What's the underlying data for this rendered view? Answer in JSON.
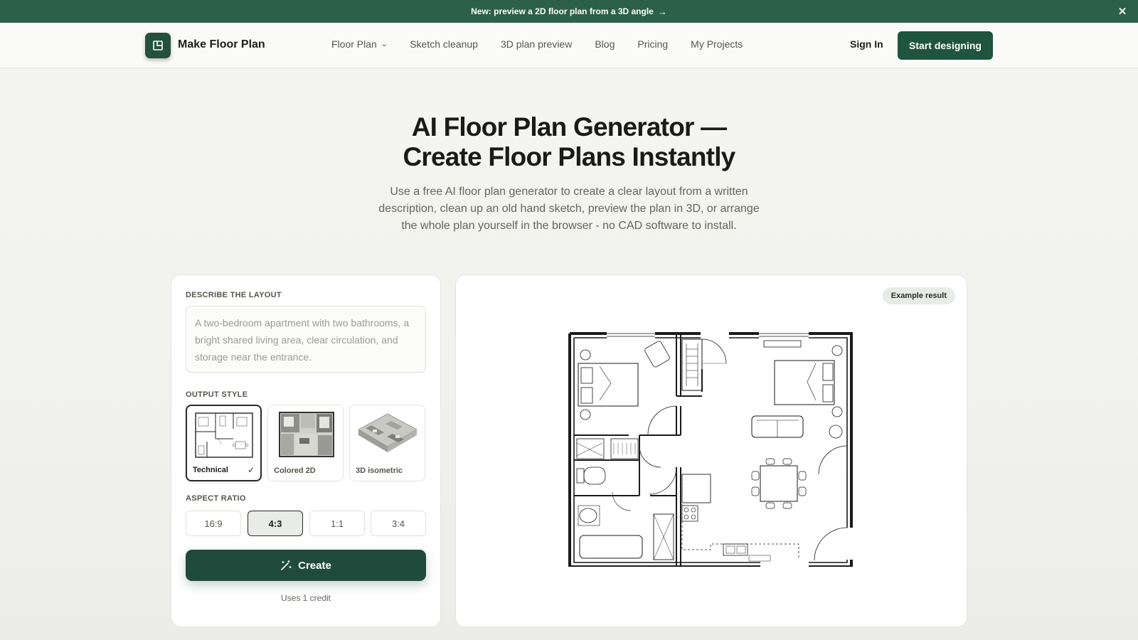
{
  "announcement": {
    "text": "New: preview a 2D floor plan from a 3D angle",
    "arrow": "→",
    "close_icon": "close-icon"
  },
  "header": {
    "brand": "Make Floor Plan",
    "logo_icon": "floor-plan-logo-icon",
    "nav": [
      {
        "label": "Floor Plan",
        "has_dropdown": true
      },
      {
        "label": "Sketch cleanup"
      },
      {
        "label": "3D plan preview"
      },
      {
        "label": "Blog"
      },
      {
        "label": "Pricing"
      },
      {
        "label": "My Projects"
      }
    ],
    "sign_in": "Sign In",
    "cta": "Start designing"
  },
  "hero": {
    "title_line1": "AI Floor Plan Generator —",
    "title_line2": "Create Floor Plans Instantly",
    "subtitle": "Use a free AI floor plan generator to create a clear layout from a written description, clean up an old hand sketch, preview the plan in 3D, or arrange the whole plan yourself in the browser - no CAD software to install."
  },
  "form": {
    "describe_label": "DESCRIBE THE LAYOUT",
    "describe_placeholder": "A two-bedroom apartment with two bathrooms, a bright shared living area, clear circulation, and storage near the entrance.",
    "output_style_label": "OUTPUT STYLE",
    "styles": [
      {
        "label": "Technical",
        "selected": true
      },
      {
        "label": "Colored 2D",
        "selected": false
      },
      {
        "label": "3D isometric",
        "selected": false
      }
    ],
    "aspect_ratio_label": "ASPECT RATIO",
    "ratios": [
      {
        "label": "16:9",
        "selected": false
      },
      {
        "label": "4:3",
        "selected": true
      },
      {
        "label": "1:1",
        "selected": false
      },
      {
        "label": "3:4",
        "selected": false
      }
    ],
    "create_label": "Create",
    "create_icon": "magic-wand-icon",
    "credit_note": "Uses 1 credit"
  },
  "preview": {
    "badge": "Example result",
    "image": "floor-plan-drawing"
  },
  "colors": {
    "banner": "#2c6048",
    "primary": "#1f5440",
    "create": "#1f4a3c"
  }
}
